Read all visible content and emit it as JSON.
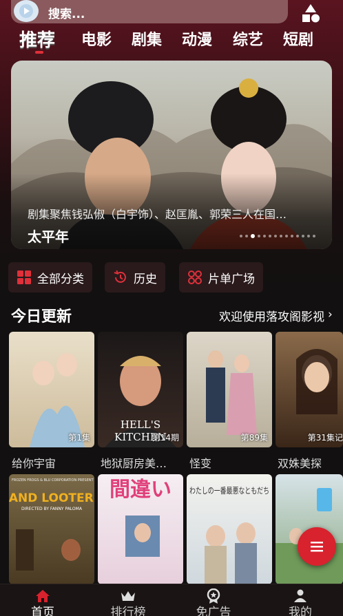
{
  "search": {
    "placeholder": "搜索..."
  },
  "tabs": [
    "推荐",
    "电影",
    "剧集",
    "动漫",
    "综艺",
    "短剧"
  ],
  "banner": {
    "description": "剧集聚焦钱弘俶（白宇饰）、赵匡胤、郭荣三人在国…",
    "title": "太平年",
    "page_count": 14,
    "active_index": 2
  },
  "quick_actions": [
    "全部分类",
    "历史",
    "片单广场"
  ],
  "section": {
    "title": "今日更新",
    "link": "欢迎使用落攻阁影视",
    "chevron": "›"
  },
  "row1": [
    {
      "title": "给你宇宙",
      "episode": "第1集",
      "color": "#d9cbb1"
    },
    {
      "title": "地狱厨房美…",
      "episode": "第14期",
      "color": "#3a2a24"
    },
    {
      "title": "怪变",
      "episode": "第89集",
      "color": "#c4bba8"
    },
    {
      "title": "双姝美探",
      "episode": "第31集记",
      "color": "#6a4a30"
    }
  ],
  "row2": [
    {
      "title": "LAND LOOTERS",
      "subtitle": "DIRECTED BY FANNY PALOMA",
      "top_text": "FROZEN FROGS & BLU CORPORATION PRESENT",
      "color": "#6b5a3a"
    },
    {
      "title": "間違い",
      "color": "#f2e6ee"
    },
    {
      "title": "わたしの一番最悪なともだち",
      "color": "#e6e9ec"
    },
    {
      "title": "",
      "color": "#bfd3dd"
    }
  ],
  "bottom_nav": [
    {
      "label": "首页",
      "icon": "home-icon",
      "active": true
    },
    {
      "label": "排行榜",
      "icon": "crown-icon",
      "active": false
    },
    {
      "label": "免广告",
      "icon": "ad-free-icon",
      "active": false
    },
    {
      "label": "我的",
      "icon": "profile-icon",
      "active": false
    }
  ],
  "colors": {
    "accent": "#d8222e",
    "background": "#121010"
  }
}
